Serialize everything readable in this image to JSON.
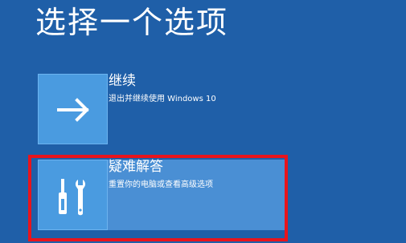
{
  "screen": {
    "title": "选择一个选项"
  },
  "options": [
    {
      "title": "继续",
      "description": "退出并继续使用 Windows 10",
      "icon": "arrow-right-icon"
    },
    {
      "title": "疑难解答",
      "description": "重置你的电脑或查看高级选项",
      "icon": "tools-icon"
    }
  ],
  "colors": {
    "background": "#1f5fa8",
    "tile": "#4a9be0",
    "highlight": "#e8141c"
  }
}
